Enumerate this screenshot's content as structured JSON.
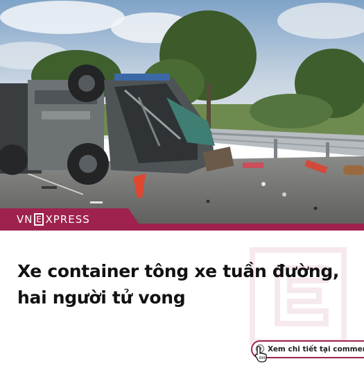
{
  "brand": {
    "logo_prefix": "VN",
    "logo_letter": "E",
    "logo_suffix": "XPRESS",
    "color": "#9f224e"
  },
  "headline": {
    "line1": "Xe container tông xe tuần đường,",
    "line2": "hai người tử vong"
  },
  "cta": {
    "label": "Xem chi tiết tại comment",
    "icon": "hand-pointer-icon"
  },
  "photo": {
    "subject": "overturned-truck-icon"
  }
}
